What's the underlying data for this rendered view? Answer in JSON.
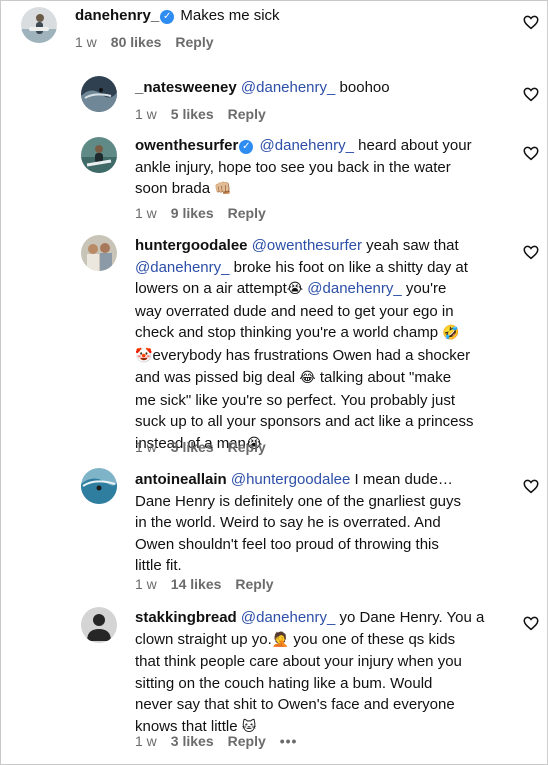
{
  "comments": [
    {
      "username": "danehenry_",
      "verified": true,
      "body": "Makes me sick",
      "time": "1 w",
      "likes": "80 likes",
      "reply": "Reply"
    },
    {
      "username": "_natesweeney",
      "mention": "@danehenry_",
      "body": "boohoo",
      "time": "1 w",
      "likes": "5 likes",
      "reply": "Reply"
    },
    {
      "username": "owenthesurfer",
      "verified": true,
      "mention": "@danehenry_",
      "body_1": "heard about your",
      "body_2": "ankle injury, hope too see you back in the water",
      "body_3": "soon brada",
      "emoji": "👊🏼",
      "time": "1 w",
      "likes": "9 likes",
      "reply": "Reply"
    },
    {
      "username": "huntergoodalee",
      "mention_1": "@owenthesurfer",
      "body_1": "yeah saw that",
      "mention_2": "@danehenry_",
      "body_2": "broke his foot on like a shitty day at",
      "body_3": "lowers on a air attempt",
      "emoji_1": "😭",
      "mention_3": "@danehenry_",
      "body_4": "you're",
      "body_5": "way overrated dude and need to get your ego in",
      "body_6": "check and stop thinking you're a world champ",
      "emoji_2": "🤣",
      "emoji_3": "🤡",
      "body_7": "everybody has frustrations Owen had a shocker",
      "body_8": "and was pissed big deal",
      "emoji_4": "😂",
      "body_9": "talking about \"make",
      "body_10": "me sick\" like you're so perfect. You probably just",
      "body_11": "suck up to all your sponsors and act like a princess",
      "body_12": "instead of a man",
      "emoji_5": "😭",
      "time": "1 w",
      "likes": "3 likes",
      "reply": "Reply"
    },
    {
      "username": "antoineallain",
      "mention": "@huntergoodalee",
      "body_1": "I mean dude…",
      "body_2": "Dane Henry is definitely one of the gnarliest guys",
      "body_3": "in the world. Weird to say he is overrated. And",
      "body_4": "Owen shouldn't feel too proud of throwing this",
      "body_5": "little fit.",
      "time": "1 w",
      "likes": "14 likes",
      "reply": "Reply"
    },
    {
      "username": "stakkingbread",
      "mention": "@danehenry_",
      "body_1": "yo Dane Henry. You a",
      "body_2": "clown straight up yo.",
      "emoji_1": "🤦",
      "body_3": "you one of these qs kids",
      "body_4": "that think people care about your injury when you",
      "body_5": "sitting on the couch hating like a bum. Would",
      "body_6": "never say that shit to Owen's face and everyone",
      "body_7": "knows that little",
      "emoji_2": "🐱",
      "time": "1 w",
      "likes": "3 likes",
      "reply": "Reply",
      "more": "•••"
    }
  ]
}
